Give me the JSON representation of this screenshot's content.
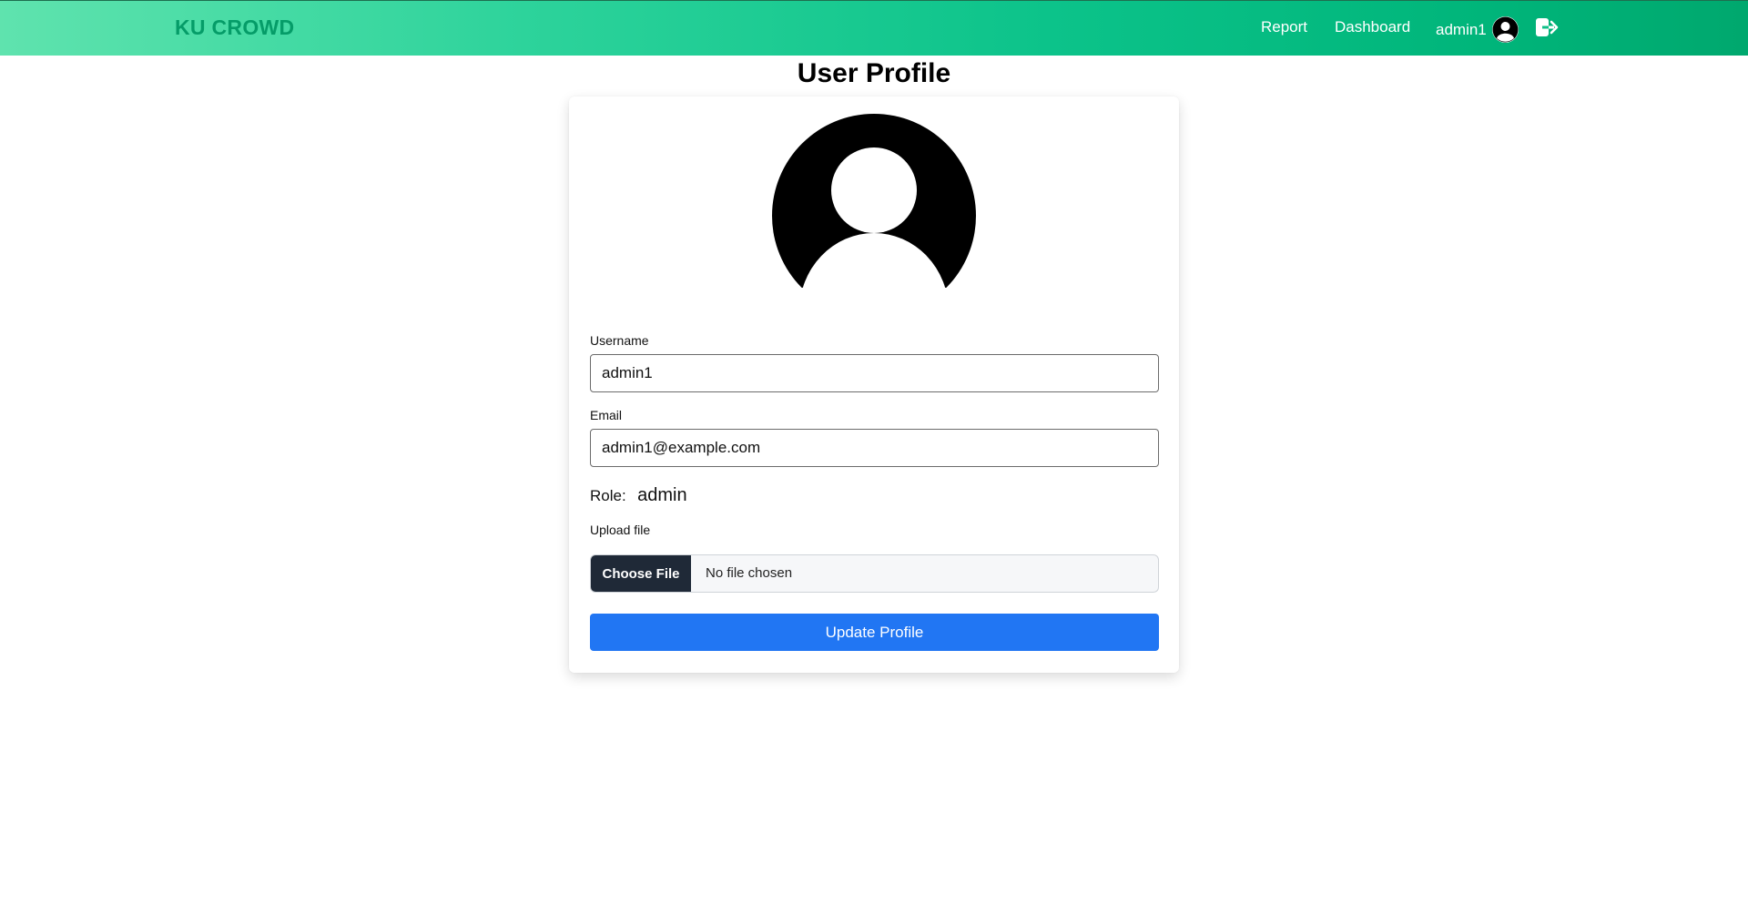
{
  "header": {
    "brand": "KU CROWD",
    "nav": {
      "report": "Report",
      "dashboard": "Dashboard",
      "username": "admin1"
    },
    "icons": {
      "avatar": "user-avatar-icon",
      "logout": "logout-icon"
    }
  },
  "page": {
    "title": "User Profile"
  },
  "profile": {
    "avatar_icon": "user-silhouette-icon",
    "username_label": "Username",
    "username_value": "admin1",
    "email_label": "Email",
    "email_value": "admin1@example.com",
    "role_label": "Role:",
    "role_value": "admin",
    "upload_label": "Upload file",
    "choose_file_label": "Choose File",
    "file_status": "No file chosen",
    "submit_label": "Update Profile"
  },
  "colors": {
    "brand_text": "#059c68",
    "header_gradient_start": "#5fe3ae",
    "header_gradient_end": "#00a86e",
    "primary_button": "#2176f3",
    "file_button": "#1f2937"
  }
}
